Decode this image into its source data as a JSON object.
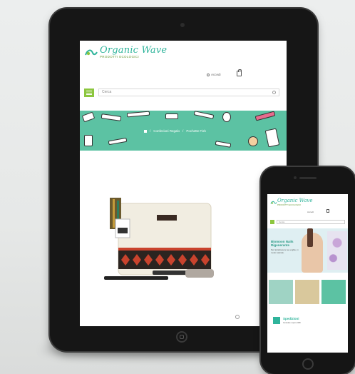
{
  "tablet": {
    "logo_title": "Organic Wave",
    "logo_subtitle": "PRODOTTI ECOLOGICI",
    "account_label": "Accedi",
    "search_placeholder": "Cerca",
    "breadcrumb": {
      "separator": "/",
      "category": "Confezioni Regalo",
      "current": "Pochette Fish"
    }
  },
  "phone": {
    "logo_title": "Organic Wave",
    "logo_subtitle": "PRODOTTI ECOLOGICI",
    "account_label": "Accedi",
    "search_placeholder": "Cerca",
    "hero_title": "Biomoon Nails Rigenerante",
    "hero_subtitle": "Per ripristinare le tue unghie, in modo naturale.",
    "bottom_title": "Spedizioni",
    "bottom_subtitle": "Gratuite sopra 40€"
  },
  "colors": {
    "brand_teal": "#2fb49b",
    "brand_green": "#8cc63f",
    "banner_green": "#5cc2a3",
    "device_body": "#161616"
  },
  "icons": [
    "home-icon",
    "user-icon",
    "cart-icon",
    "menu-icon",
    "search-icon",
    "zoom-icon",
    "logo-wave-icon"
  ]
}
